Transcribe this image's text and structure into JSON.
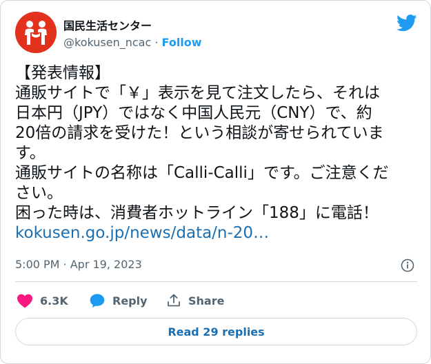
{
  "tweet": {
    "author": {
      "display_name": "国民生活センター",
      "handle": "@kokusen_ncac",
      "separator": "·",
      "follow_label": "Follow"
    },
    "body_lines": [
      "【発表情報】",
      "通販サイトで「￥」表示を見て注文したら、それは",
      "日本円（JPY）ではなく中国人民元（CNY）で、約",
      "20倍の請求を受けた！という相談が寄せられていま",
      "す。",
      "通販サイトの名称は「Calli-Calli」です。ご注意くだ",
      "さい。",
      "困った時は、消費者ホットライン「188」に電話！"
    ],
    "link_text": "kokusen.go.jp/news/data/n-20…",
    "timestamp": "5:00 PM · Apr 19, 2023",
    "actions": {
      "likes_count": "6.3K",
      "reply_label": "Reply",
      "share_label": "Share"
    },
    "read_replies_label": "Read 29 replies"
  },
  "colors": {
    "accent_blue": "#1d9bf0",
    "link_blue": "#1b6fb1",
    "like_pink": "#f91880",
    "avatar_red": "#e2321d",
    "muted_text": "#536471",
    "border": "#cfd9de"
  },
  "icons": {
    "brand": "twitter-bird-icon",
    "info": "info-icon",
    "like": "heart-icon",
    "reply": "speech-bubble-icon",
    "share": "share-icon"
  }
}
